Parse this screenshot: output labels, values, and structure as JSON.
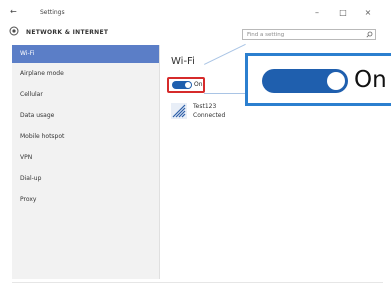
{
  "window": {
    "title": "Settings",
    "controls": {
      "minimize": "–",
      "maximize": "□",
      "close": "×"
    }
  },
  "header": {
    "section": "NETWORK & INTERNET",
    "search_placeholder": "Find a setting"
  },
  "sidebar": {
    "items": [
      {
        "label": "Wi-Fi",
        "selected": true
      },
      {
        "label": "Airplane mode"
      },
      {
        "label": "Cellular"
      },
      {
        "label": "Data usage"
      },
      {
        "label": "Mobile hotspot"
      },
      {
        "label": "VPN"
      },
      {
        "label": "Dial-up"
      },
      {
        "label": "Proxy"
      }
    ]
  },
  "main": {
    "title": "Wi-Fi",
    "toggle": {
      "label": "On",
      "state": "on"
    },
    "network": {
      "name": "Test123",
      "status": "Connected"
    }
  },
  "zoom": {
    "toggle_label": "On"
  },
  "icons": {
    "back": "back-arrow-icon",
    "settings": "gear-icon",
    "search": "search-icon",
    "wifi": "wifi-icon"
  },
  "colors": {
    "accent": "#5b7ec7",
    "toggle_on": "#1f5fae",
    "highlight_border": "#d62b2b",
    "callout_border": "#2b7fcf"
  }
}
